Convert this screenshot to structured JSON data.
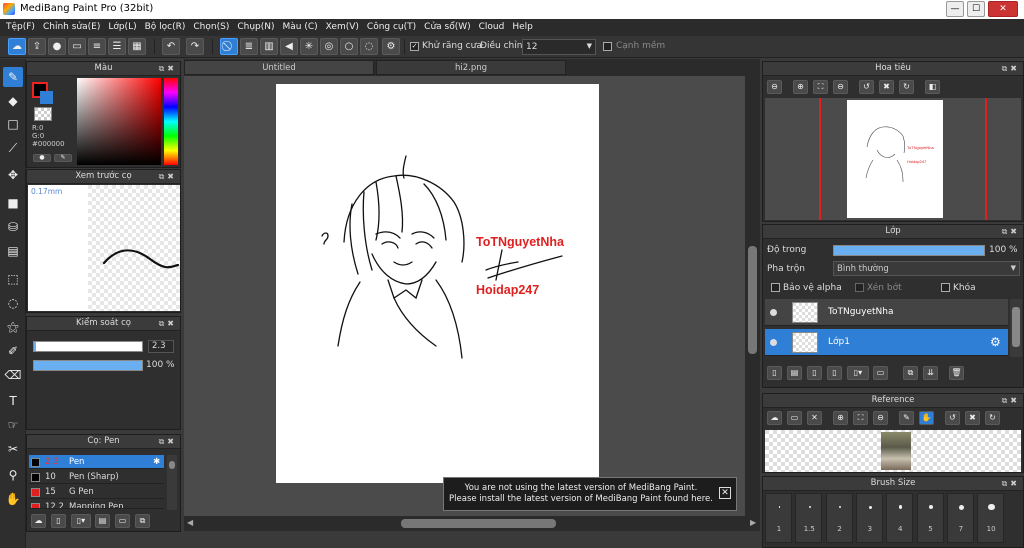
{
  "window": {
    "title": "MediBang Paint Pro (32bit)",
    "minimize": "—",
    "maximize": "☐",
    "close": "✕"
  },
  "menu": [
    "Tệp(F)",
    "Chỉnh sửa(E)",
    "Lớp(L)",
    "Bộ lọc(R)",
    "Chọn(S)",
    "Chụp(N)",
    "Màu (C)",
    "Xem(V)",
    "Công cụ(T)",
    "Cửa sổ(W)",
    "Cloud",
    "Help"
  ],
  "toolbar": {
    "antialias_label": "Khử răng cưa",
    "adjust_label": "Điều chỉnh",
    "adjust_value": "12",
    "edge_label": "Cạnh mềm"
  },
  "color_panel": {
    "title": "Màu",
    "r": "R:0",
    "g": "G:0",
    "hex": "#000000"
  },
  "brush_preview": {
    "title": "Xem trước cọ",
    "size": "0.17mm"
  },
  "brush_control": {
    "title": "Kiểm soát cọ",
    "size_value": "2.3",
    "opacity_value": "100 %",
    "size_level": 0.02,
    "opacity_level": 1.0
  },
  "brush_panel": {
    "title": "Cọ: Pen",
    "items": [
      {
        "size": "2.3",
        "name": "Pen",
        "color": "#000000",
        "selected": true
      },
      {
        "size": "10",
        "name": "Pen (Sharp)",
        "color": "#000000",
        "selected": false
      },
      {
        "size": "15",
        "name": "G Pen",
        "color": "#e02020",
        "selected": false
      },
      {
        "size": "12.2",
        "name": "Mapping Pen",
        "color": "#e02020",
        "selected": false
      }
    ]
  },
  "tabs": [
    "Untitled",
    "hi2.png"
  ],
  "canvas": {
    "text1": "ToTNguyetNha",
    "text2": "Hoidap247",
    "text_color": "#e02020"
  },
  "notice": {
    "line1": "You are not using the latest version of MediBang Paint.",
    "line2": "Please install the latest version of MediBang Paint found here."
  },
  "navigator": {
    "title": "Hoa tiêu"
  },
  "layer_panel": {
    "title": "Lớp",
    "opacity_label": "Độ trong",
    "opacity_value": "100 %",
    "opacity_level": 1.0,
    "blend_label": "Pha trộn",
    "blend_value": "Bình thường",
    "protect_alpha": "Bảo vệ alpha",
    "clipping": "Xén bớt",
    "lock": "Khóa",
    "layers": [
      {
        "name": "ToTNguyetNha",
        "selected": false
      },
      {
        "name": "Lớp1",
        "selected": true
      }
    ]
  },
  "reference": {
    "title": "Reference"
  },
  "brush_size": {
    "title": "Brush Size",
    "sizes": [
      "1",
      "1.5",
      "2",
      "3",
      "4",
      "5",
      "7",
      "10"
    ]
  }
}
